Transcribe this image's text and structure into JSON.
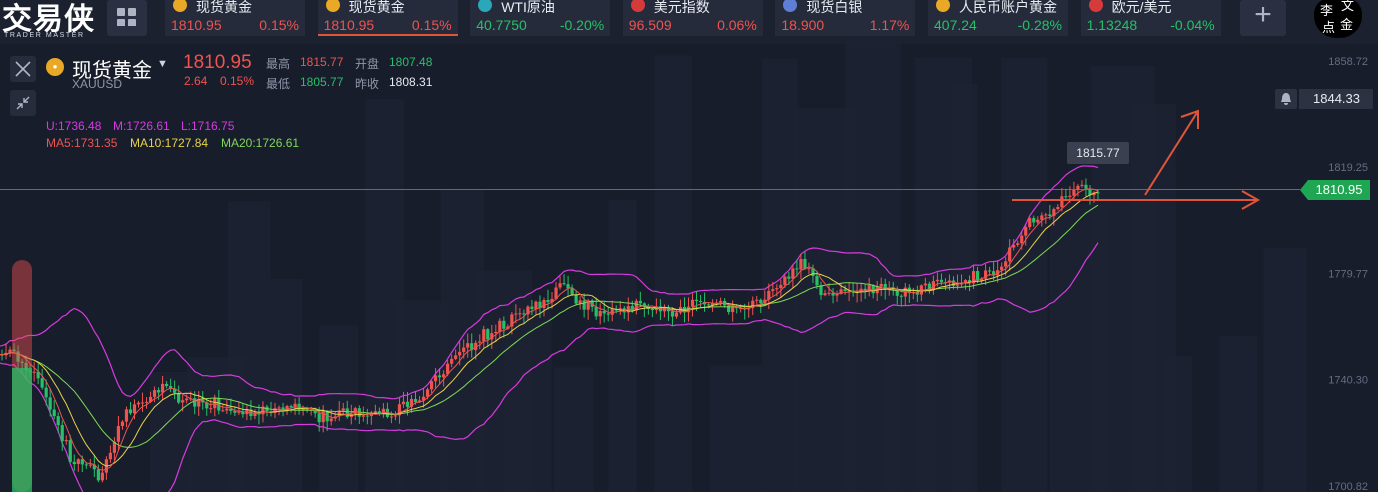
{
  "brand": {
    "cn": "交易侠",
    "en": "TRADER MASTER"
  },
  "seal": [
    "李",
    "文",
    "点",
    "金"
  ],
  "ticker": [
    {
      "name": "现货黄金",
      "price": "1810.95",
      "change": "0.15%",
      "dir": "up",
      "icon": "gold-coin-icon",
      "color": "#e9a825"
    },
    {
      "name": "现货黄金",
      "price": "1810.95",
      "change": "0.15%",
      "dir": "up",
      "icon": "gold-coin-icon",
      "color": "#e9a825",
      "active": true
    },
    {
      "name": "WTI原油",
      "price": "40.7750",
      "change": "-0.20%",
      "dir": "down",
      "icon": "oil-barrel-icon",
      "color": "#2aa7b8"
    },
    {
      "name": "美元指数",
      "price": "96.509",
      "change": "0.06%",
      "dir": "up",
      "icon": "us-flag-icon",
      "color": "#d63b3b"
    },
    {
      "name": "现货白银",
      "price": "18.900",
      "change": "1.17%",
      "dir": "up",
      "icon": "silver-icon",
      "color": "#5d7fd6"
    },
    {
      "name": "人民币账户黄金",
      "price": "407.24",
      "change": "-0.28%",
      "dir": "down",
      "icon": "gold-coin-icon",
      "color": "#e9a825"
    },
    {
      "name": "欧元/美元",
      "price": "1.13248",
      "change": "-0.04%",
      "dir": "down",
      "icon": "us-flag-icon",
      "color": "#d63b3b"
    }
  ],
  "symbol": {
    "name": "现货黄金",
    "code": "XAUUSD",
    "price": "1810.95",
    "change": "2.64",
    "change_pct": "0.15%",
    "high_label": "最高",
    "high": "1815.77",
    "low_label": "最低",
    "low": "1805.77",
    "open_label": "开盘",
    "open": "1807.48",
    "prev_label": "昨收",
    "prev": "1808.31"
  },
  "indicators": {
    "boll": [
      {
        "text": "U:1736.48",
        "color": "#d63be0"
      },
      {
        "text": "M:1726.61",
        "color": "#d63be0"
      },
      {
        "text": "L:1716.75",
        "color": "#d63be0"
      }
    ],
    "ma": [
      {
        "text": "MA5:1731.35",
        "color": "#ef5350"
      },
      {
        "text": "MA10:1727.84",
        "color": "#e6d34a"
      },
      {
        "text": "MA20:1726.61",
        "color": "#7ed957"
      }
    ]
  },
  "alert": {
    "value": "1844.33"
  },
  "current_tag": "1810.95",
  "high_tag": "1815.77",
  "chart_data": {
    "type": "candlestick",
    "y_ticks": [
      "1858.72",
      "1819.25",
      "1779.77",
      "1740.30",
      "1700.82"
    ],
    "ylim": [
      1700.82,
      1858.72
    ],
    "current_price": 1810.95,
    "high_marker": 1815.77,
    "alert_price": 1844.33,
    "colors": {
      "up": "#ef5350",
      "down": "#26c068",
      "boll": "#d63be0",
      "ma5": "#ef5350",
      "ma10": "#e6d34a",
      "ma20": "#7ed957",
      "price_line": "#1fa653",
      "annot": "#e0553a"
    },
    "anchors": [
      [
        0,
        1752
      ],
      [
        8,
        1745
      ],
      [
        12,
        1735
      ],
      [
        18,
        1712
      ],
      [
        25,
        1705
      ],
      [
        32,
        1727
      ],
      [
        40,
        1738
      ],
      [
        48,
        1732
      ],
      [
        56,
        1731
      ],
      [
        64,
        1728
      ],
      [
        72,
        1731
      ],
      [
        80,
        1726
      ],
      [
        88,
        1729
      ],
      [
        96,
        1728
      ],
      [
        104,
        1732
      ],
      [
        112,
        1745
      ],
      [
        120,
        1756
      ],
      [
        128,
        1763
      ],
      [
        136,
        1769
      ],
      [
        140,
        1776
      ],
      [
        146,
        1768
      ],
      [
        152,
        1764
      ],
      [
        160,
        1768
      ],
      [
        168,
        1765
      ],
      [
        176,
        1770
      ],
      [
        184,
        1767
      ],
      [
        190,
        1770
      ],
      [
        196,
        1779
      ],
      [
        200,
        1783
      ],
      [
        206,
        1772
      ],
      [
        212,
        1773
      ],
      [
        220,
        1774
      ],
      [
        228,
        1773
      ],
      [
        236,
        1777
      ],
      [
        242,
        1778
      ],
      [
        248,
        1780
      ],
      [
        252,
        1788
      ],
      [
        256,
        1797
      ],
      [
        262,
        1803
      ],
      [
        268,
        1810
      ],
      [
        274,
        1811
      ]
    ],
    "candle_count": 275,
    "seed": 7
  }
}
